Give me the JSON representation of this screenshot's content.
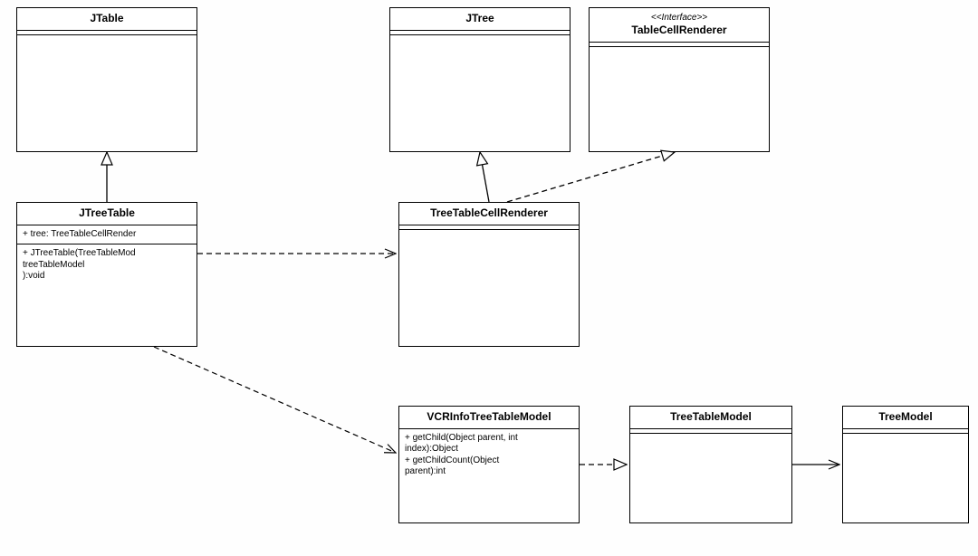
{
  "diagram_type": "UML Class Diagram",
  "classes": {
    "jtable": {
      "name": "JTable"
    },
    "jtree": {
      "name": "JTree"
    },
    "renderer_if": {
      "stereotype": "<<Interface>>",
      "name": "TableCellRenderer"
    },
    "jtreetable": {
      "name": "JTreeTable",
      "attrs": "+ tree: TreeTableCellRender",
      "ops": "+ JTreeTable(TreeTableMod\ntreeTableModel\n):void"
    },
    "ttcr": {
      "name": "TreeTableCellRenderer"
    },
    "vcr": {
      "name": "VCRInfoTreeTableModel",
      "ops": "+ getChild(Object parent, int\nindex):Object\n+ getChildCount(Object\nparent):int"
    },
    "ttm": {
      "name": "TreeTableModel"
    },
    "tm": {
      "name": "TreeModel"
    }
  },
  "relationships": [
    {
      "from": "JTreeTable",
      "to": "JTable",
      "kind": "generalization"
    },
    {
      "from": "TreeTableCellRenderer",
      "to": "JTree",
      "kind": "generalization"
    },
    {
      "from": "TreeTableCellRenderer",
      "to": "TableCellRenderer",
      "kind": "realization"
    },
    {
      "from": "JTreeTable",
      "to": "TreeTableCellRenderer",
      "kind": "dependency"
    },
    {
      "from": "JTreeTable",
      "to": "VCRInfoTreeTableModel",
      "kind": "dependency"
    },
    {
      "from": "VCRInfoTreeTableModel",
      "to": "TreeTableModel",
      "kind": "realization"
    },
    {
      "from": "TreeTableModel",
      "to": "TreeModel",
      "kind": "association_directed"
    }
  ]
}
